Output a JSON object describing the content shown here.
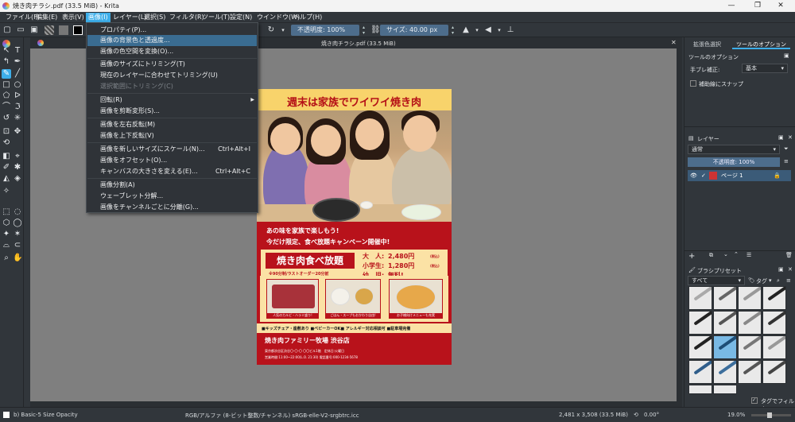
{
  "window": {
    "title": "焼き肉チラシ.pdf (33.5 MiB) - Krita",
    "minimize_glyph": "—",
    "maximize_glyph": "❐",
    "close_glyph": "✕"
  },
  "menubar": [
    "ファイル(F)",
    "編集(E)",
    "表示(V)",
    "画像(I)",
    "レイヤー(L)",
    "選択(S)",
    "フィルタ(R)",
    "ツール(T)",
    "設定(N)",
    "ウインドウ(W)",
    "ヘルプ(H)"
  ],
  "toolbar": {
    "opacity_label": "不透明度: 100%",
    "size_label": "サイズ: 40.00 px"
  },
  "document_tab": "焼き肉チラシ.pdf (33.5 MiB)",
  "image_menu": {
    "items": [
      {
        "label": "プロパティ(P)...",
        "shortcut": "",
        "disabled": false,
        "highlighted": false,
        "submenu": false
      },
      {
        "label": "画像の背景色と透過度...",
        "shortcut": "",
        "disabled": false,
        "highlighted": true,
        "submenu": false
      },
      {
        "label": "画像の色空間を変換(O)...",
        "shortcut": "",
        "disabled": false,
        "highlighted": false,
        "submenu": false
      },
      {
        "label": "画像のサイズにトリミング(T)",
        "shortcut": "",
        "disabled": false,
        "highlighted": false,
        "submenu": false
      },
      {
        "label": "現在のレイヤーに合わせてトリミング(U)",
        "shortcut": "",
        "disabled": false,
        "highlighted": false,
        "submenu": false
      },
      {
        "label": "選択範囲にトリミング(C)",
        "shortcut": "",
        "disabled": true,
        "highlighted": false,
        "submenu": false
      },
      {
        "label": "回転(R)",
        "shortcut": "",
        "disabled": false,
        "highlighted": false,
        "submenu": true
      },
      {
        "label": "画像を剪断変形(S)...",
        "shortcut": "",
        "disabled": false,
        "highlighted": false,
        "submenu": false
      },
      {
        "label": "画像を左右反転(M)",
        "shortcut": "",
        "disabled": false,
        "highlighted": false,
        "submenu": false
      },
      {
        "label": "画像を上下反転(V)",
        "shortcut": "",
        "disabled": false,
        "highlighted": false,
        "submenu": false
      },
      {
        "label": "画像を新しいサイズにスケール(N)...",
        "shortcut": "Ctrl+Alt+I",
        "disabled": false,
        "highlighted": false,
        "submenu": false
      },
      {
        "label": "画像をオフセット(O)...",
        "shortcut": "",
        "disabled": false,
        "highlighted": false,
        "submenu": false
      },
      {
        "label": "キャンバスの大きさを変える(E)...",
        "shortcut": "Ctrl+Alt+C",
        "disabled": false,
        "highlighted": false,
        "submenu": false
      },
      {
        "label": "画像分割(A)",
        "shortcut": "",
        "disabled": false,
        "highlighted": false,
        "submenu": false
      },
      {
        "label": "ウェーブレット分解...",
        "shortcut": "",
        "disabled": false,
        "highlighted": false,
        "submenu": false
      },
      {
        "label": "画像をチャンネルごとに分離(G)...",
        "shortcut": "",
        "disabled": false,
        "highlighted": false,
        "submenu": false
      }
    ]
  },
  "flyer": {
    "headline": "週末は家族でワイワイ焼き肉",
    "line1": "あの味を家族で楽しもう!",
    "line2": "今だけ限定、食べ放題キャンペーン開催中!",
    "plan_title": "焼き肉食べ放題",
    "plan_note": "※90分制/ラストオーダー20分前",
    "prices": [
      {
        "who": "大　人:",
        "price": "2,480円",
        "tax": "(税込)"
      },
      {
        "who": "小学生:",
        "price": "1,280円",
        "tax": "(税込)"
      },
      {
        "who": "幼　児:",
        "price": "無料!",
        "tax": ""
      }
    ],
    "food_captions": [
      "人気のカルビ・ハラミ盛り!",
      "ごはん・スープもおかわり自由!",
      "お子様向けメニューも充実"
    ],
    "features": "■キッズチェア・座敷あり ■ベビーカーOK■ アレルギー対応相談可 ■駐車場完備",
    "store_name": "焼き肉ファミリー牧場 渋谷店",
    "address": "東京都渋谷区渋谷〇-〇-〇 〇〇ビル1階　定休日:火曜日",
    "hours": "営業時間:11:00~22:00(L.O. 21:30) 電話番号:000-1234-5678"
  },
  "dock": {
    "tabs": [
      "拡張色選択",
      "ツールのオプション"
    ],
    "tool_options_title": "ツールのオプション",
    "smoothing_label": "手ブレ補正:",
    "smoothing_value": "基本",
    "assistant_label": "補助線にスナップ",
    "layers_title": "レイヤー",
    "blend_mode": "通常",
    "layer_opacity": "不透明度: 100%",
    "layer_name": "ページ 1",
    "brush_title": "ブラシプリセット",
    "brush_filter": "すべて",
    "brush_tag": "タグ",
    "filter_by_tag": "タグでフィルタ"
  },
  "status": {
    "brush": "b) Basic-5 Size Opacity",
    "colorspace": "RGB/アルファ (8-ビット整数/チャンネル)  sRGB-elle-V2-srgbtrc.icc",
    "dimensions": "2,481 x 3,508 (33.5 MiB)",
    "rotation": "0.00°",
    "zoom": "19.0%"
  },
  "colors": {
    "accent": "#3daee9",
    "flyer_red": "#b8121b",
    "flyer_yellow": "#f8d36b"
  }
}
